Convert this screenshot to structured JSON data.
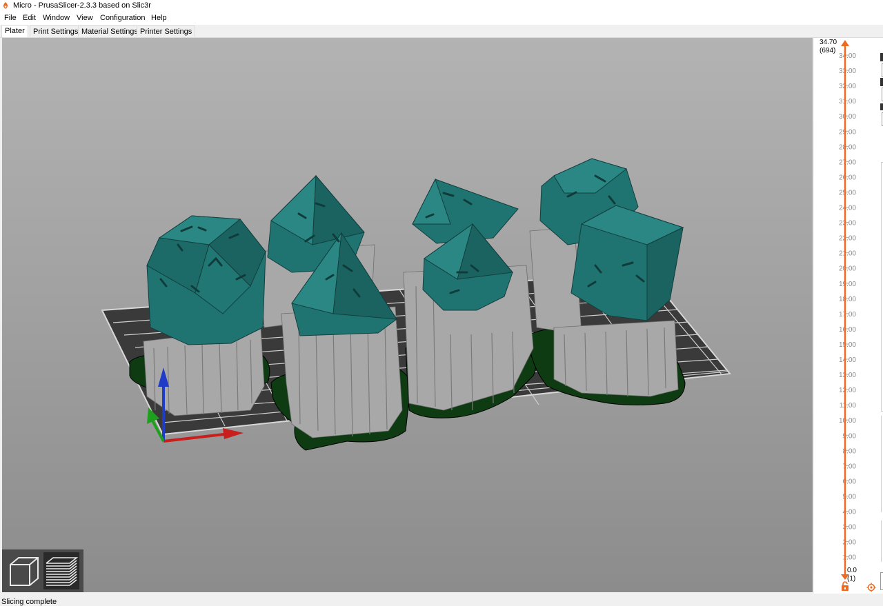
{
  "window": {
    "title": "Micro - PrusaSlicer-2.3.3 based on Slic3r"
  },
  "menu": [
    "File",
    "Edit",
    "Window",
    "View",
    "Configuration",
    "Help"
  ],
  "tabs": [
    "Plater",
    "Print Settings",
    "Material Settings",
    "Printer Settings"
  ],
  "active_tab": "Plater",
  "layer_slider": {
    "top_value": "34.70",
    "top_layer": "(694)",
    "bottom_value": "0.05",
    "bottom_layer": "(1)",
    "ticks": [
      "34.00",
      "33.00",
      "32.00",
      "31.00",
      "30.00",
      "29.00",
      "28.00",
      "27.00",
      "26.00",
      "25.00",
      "24.00",
      "23.00",
      "22.00",
      "21.00",
      "20.00",
      "19.00",
      "18.00",
      "17.00",
      "16.00",
      "15.00",
      "14.00",
      "13.00",
      "12.00",
      "11.00",
      "10.00",
      "9.00",
      "8.00",
      "7.00",
      "6.00",
      "5.00",
      "4.00",
      "3.00",
      "2.00",
      "1.00"
    ],
    "accent_color": "#ed6b21"
  },
  "view_toggle": {
    "items": [
      "3d-view",
      "preview"
    ],
    "active": "preview"
  },
  "status": {
    "text": "Slicing complete"
  },
  "colors": {
    "model": "#1f6f6d",
    "support": "#a9a9a9",
    "skirt": "#0e3b12",
    "bed": "#3c3c3c",
    "accent": "#ed6b21"
  }
}
